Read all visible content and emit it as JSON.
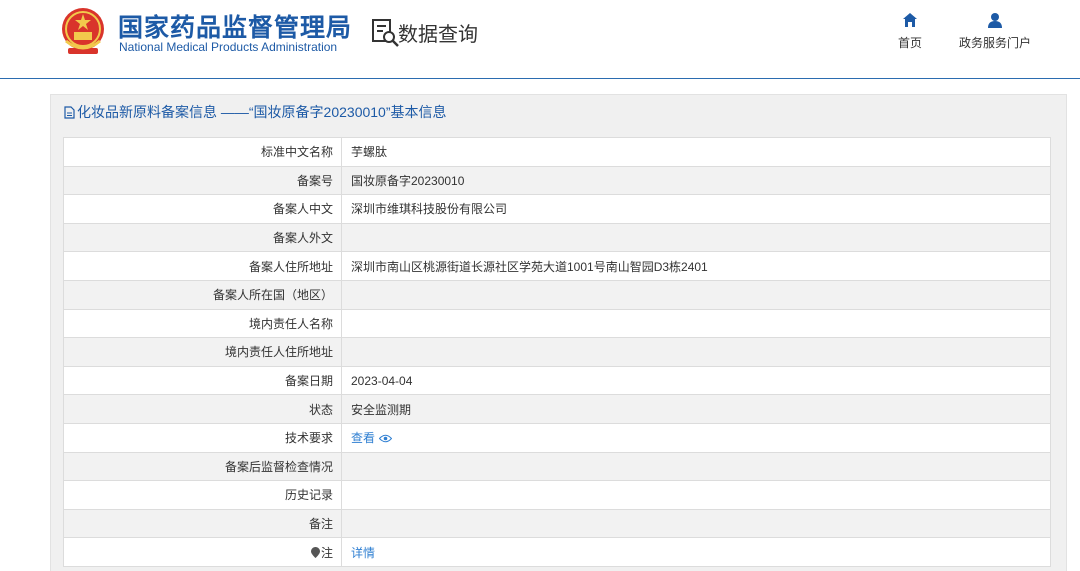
{
  "header": {
    "org_name_cn": "国家药品监督管理局",
    "org_name_en": "National Medical Products Administration",
    "section_title": "数据查询",
    "nav": [
      {
        "label": "首页",
        "icon": "home-icon"
      },
      {
        "label": "政务服务门户",
        "icon": "user-icon"
      }
    ]
  },
  "panel": {
    "title": "化妆品新原料备案信息 ——“国妆原备字20230010”基本信息"
  },
  "record": {
    "rows": [
      {
        "label": "标准中文名称",
        "value": "芋螺肽"
      },
      {
        "label": "备案号",
        "value": "国妆原备字20230010"
      },
      {
        "label": "备案人中文",
        "value": "深圳市维琪科技股份有限公司"
      },
      {
        "label": "备案人外文",
        "value": ""
      },
      {
        "label": "备案人住所地址",
        "value": "深圳市南山区桃源街道长源社区学苑大道1001号南山智园D3栋2401"
      },
      {
        "label": "备案人所在国（地区）",
        "value": ""
      },
      {
        "label": "境内责任人名称",
        "value": ""
      },
      {
        "label": "境内责任人住所地址",
        "value": ""
      },
      {
        "label": "备案日期",
        "value": "2023-04-04"
      },
      {
        "label": "状态",
        "value": "安全监测期"
      },
      {
        "label": "技术要求",
        "value": "查看",
        "link": true,
        "icon": "eye-icon"
      },
      {
        "label": "备案后监督检查情况",
        "value": ""
      },
      {
        "label": "历史记录",
        "value": ""
      },
      {
        "label": "备注",
        "value": ""
      },
      {
        "label": "注",
        "value": "详情",
        "link": true,
        "label_icon": "location-pin-icon"
      }
    ]
  },
  "colors": {
    "brand_blue": "#1d5aa6",
    "link_blue": "#2f7fd2"
  }
}
